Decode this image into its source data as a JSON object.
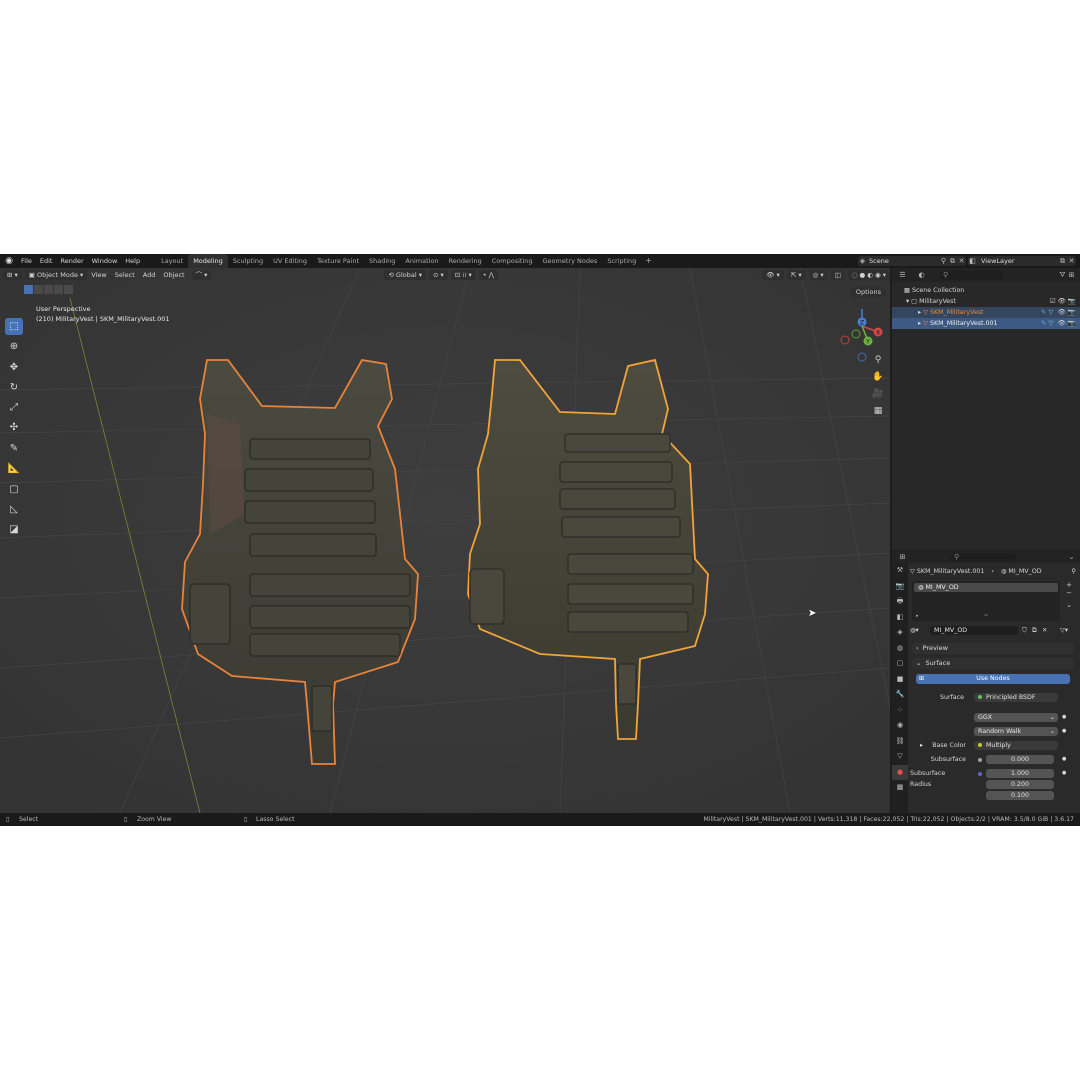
{
  "menu": {
    "items": [
      "File",
      "Edit",
      "Render",
      "Window",
      "Help"
    ]
  },
  "workspaces": {
    "tabs": [
      "Layout",
      "Modeling",
      "Sculpting",
      "UV Editing",
      "Texture Paint",
      "Shading",
      "Animation",
      "Rendering",
      "Compositing",
      "Geometry Nodes",
      "Scripting"
    ],
    "active": "Modeling"
  },
  "scene": {
    "name": "Scene",
    "view_layer": "ViewLayer"
  },
  "viewport": {
    "mode": "Object Mode",
    "menus": [
      "View",
      "Select",
      "Add",
      "Object"
    ],
    "orientation": "Global",
    "options_label": "Options",
    "info_line1": "User Perspective",
    "info_line2": "(210) MilitaryVest | SKM_MilitaryVest.001",
    "gizmo": {
      "x": "X",
      "y": "Y",
      "z": "Z"
    }
  },
  "outliner": {
    "scene_collection": "Scene Collection",
    "collection": "MilitaryVest",
    "objects": [
      "SKM_MilitaryVest",
      "SKM_MilitaryVest.001"
    ]
  },
  "properties": {
    "breadcrumb_object": "SKM_MilitaryVest.001",
    "breadcrumb_material": "MI_MV_OD",
    "slot": "MI_MV_OD",
    "material_name": "MI_MV_OD",
    "preview_label": "Preview",
    "surface_panel": "Surface",
    "use_nodes": "Use Nodes",
    "surface_label": "Surface",
    "surface_value": "Principled BSDF",
    "distribution": "GGX",
    "subsurface_method": "Random Walk",
    "base_color_label": "Base Color",
    "base_color_value": "Multiply",
    "subsurface_label": "Subsurface",
    "subsurface_value": "0.000",
    "subsurface_radius_label": "Subsurface Radius",
    "subsurface_radius": [
      "1.000",
      "0.200",
      "0.100"
    ]
  },
  "statusbar": {
    "hint1": "Select",
    "hint2": "Zoom View",
    "hint3": "Lasso Select",
    "stats": "MilitaryVest | SKM_MilitaryVest.001 | Verts:11,318 | Faces:22,052 | Tris:22,052 | Objects:2/2 | VRAM: 3.5/8.0 GiB | 3.6.17"
  },
  "colors": {
    "accent": "#4772b3",
    "selected_orange": "#e8833a",
    "active_yellow": "#f0a43a"
  }
}
